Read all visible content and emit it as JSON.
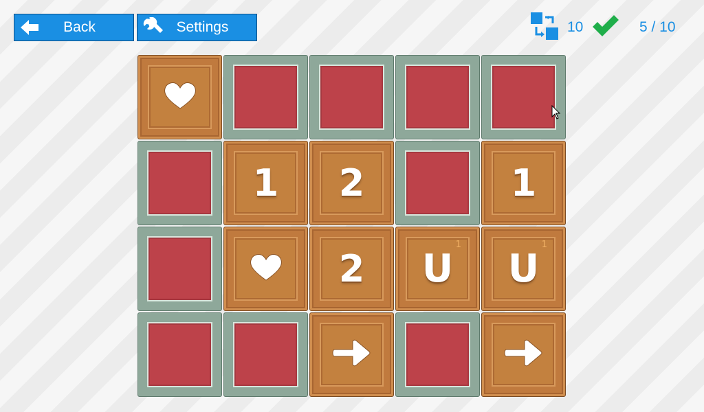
{
  "toolbar": {
    "back_label": "Back",
    "settings_label": "Settings"
  },
  "hud": {
    "moves": "10",
    "progress": "5 / 10"
  },
  "colors": {
    "accent": "#1a8fe3",
    "check": "#1fae4a",
    "empty_tile": "#bd424a",
    "crate": "#c07a3e"
  },
  "board": {
    "rows": [
      [
        {
          "type": "crate",
          "glyph": "heart"
        },
        {
          "type": "empty"
        },
        {
          "type": "empty"
        },
        {
          "type": "empty"
        },
        {
          "type": "empty"
        }
      ],
      [
        {
          "type": "empty"
        },
        {
          "type": "crate",
          "glyph": "text",
          "text": "1"
        },
        {
          "type": "crate",
          "glyph": "text",
          "text": "2"
        },
        {
          "type": "empty"
        },
        {
          "type": "crate",
          "glyph": "text",
          "text": "1"
        }
      ],
      [
        {
          "type": "empty"
        },
        {
          "type": "crate",
          "glyph": "heart"
        },
        {
          "type": "crate",
          "glyph": "text",
          "text": "2"
        },
        {
          "type": "crate",
          "glyph": "u",
          "text": "U",
          "sup": "1"
        },
        {
          "type": "crate",
          "glyph": "u",
          "text": "U",
          "sup": "1"
        }
      ],
      [
        {
          "type": "empty"
        },
        {
          "type": "empty"
        },
        {
          "type": "crate",
          "glyph": "arrow-right"
        },
        {
          "type": "empty"
        },
        {
          "type": "crate",
          "glyph": "arrow-right"
        }
      ]
    ]
  }
}
